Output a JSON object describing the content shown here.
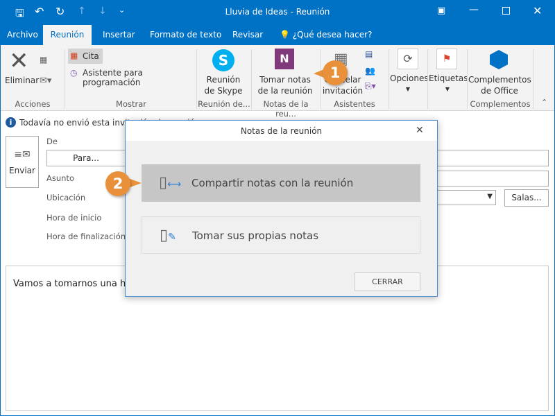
{
  "window": {
    "title": "Lluvia de Ideas  -  Reunión"
  },
  "tabs": [
    {
      "label": "Archivo"
    },
    {
      "label": "Reunión"
    },
    {
      "label": "Insertar"
    },
    {
      "label": "Formato de texto"
    },
    {
      "label": "Revisar"
    },
    {
      "label": "¿Qué desea hacer?"
    }
  ],
  "ribbon": {
    "acciones": {
      "eliminar": "Eliminar",
      "label": "Acciones"
    },
    "mostrar": {
      "cita": "Cita",
      "asistente": "Asistente para programación",
      "label": "Mostrar"
    },
    "skype": {
      "line1": "Reunión",
      "line2": "de Skype",
      "label": "Reunión de..."
    },
    "notas": {
      "line1": "Tomar notas",
      "line2": "de la reunión",
      "label": "Notas de la reu..."
    },
    "asistentes": {
      "line1": "Cancelar",
      "line2": "invitación",
      "label": "Asistentes"
    },
    "opciones": {
      "label": "Opciones"
    },
    "etiquetas": {
      "label": "Etiquetas"
    },
    "complementos": {
      "line1": "Complementos",
      "line2": "de Office",
      "label": "Complementos"
    }
  },
  "info_bar": "Todavía no envió esta invitación de reunión.",
  "form": {
    "send": "Enviar",
    "de": "De",
    "para": "Para...",
    "asunto": "Asunto",
    "ubicacion": "Ubicación",
    "salas": "Salas...",
    "inicio": "Hora de inicio",
    "fin": "Hora de finalización",
    "body": "Vamos a tomarnos una hora"
  },
  "dialog": {
    "title": "Notas de la reunión",
    "option1": "Compartir notas con la reunión",
    "option2": "Tomar sus propias notas",
    "close": "CERRAR"
  },
  "callouts": [
    "1",
    "2"
  ],
  "colors": {
    "accent": "#0072c6",
    "callout": "#e8913a"
  }
}
